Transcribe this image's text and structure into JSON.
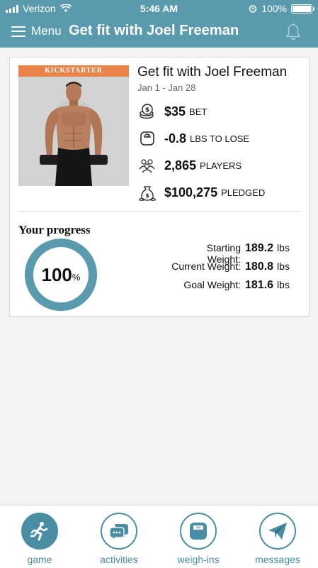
{
  "status_bar": {
    "carrier": "Verizon",
    "time": "5:46 AM",
    "battery": "100%"
  },
  "nav": {
    "menu_label": "Menu",
    "title": "Get fit with Joel Freeman"
  },
  "game": {
    "cover_banner": "KICKSTARTER",
    "title": "Get fit with Joel Freeman",
    "dates": "Jan 1 - Jan 28",
    "stats": [
      {
        "icon": "coins-icon",
        "value": "$35",
        "label": "BET"
      },
      {
        "icon": "scale-icon",
        "value": "-0.8",
        "label": "LBS TO LOSE"
      },
      {
        "icon": "players-icon",
        "value": "2,865",
        "label": "PLAYERS"
      },
      {
        "icon": "money-bag-icon",
        "value": "$100,275",
        "label": "PLEDGED"
      }
    ]
  },
  "progress": {
    "title": "Your progress",
    "percent_value": 100,
    "percent_text": "100",
    "percent_sign": "%",
    "weights": [
      {
        "label": "Starting Weight:",
        "value": "189.2",
        "unit": "lbs"
      },
      {
        "label": "Current Weight:",
        "value": "180.8",
        "unit": "lbs"
      },
      {
        "label": "Goal Weight:",
        "value": "181.6",
        "unit": "lbs"
      }
    ]
  },
  "tabs": [
    {
      "label": "game",
      "icon": "runner-icon",
      "active": true
    },
    {
      "label": "activities",
      "icon": "chat-bubbles-icon",
      "active": false
    },
    {
      "label": "weigh-ins",
      "icon": "scale-icon",
      "active": false
    },
    {
      "label": "messages",
      "icon": "paper-plane-icon",
      "active": false
    }
  ],
  "colors": {
    "accent": "#5a9aad",
    "tab_accent": "#4a8ea3",
    "banner": "#e8834a",
    "background": "#f3f3f3"
  }
}
